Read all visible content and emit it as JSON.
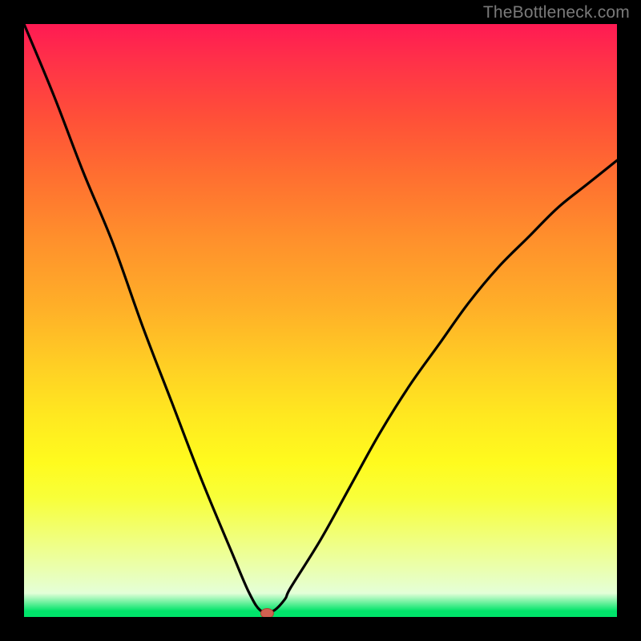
{
  "watermark": "TheBottleneck.com",
  "chart_data": {
    "type": "line",
    "title": "",
    "xlabel": "",
    "ylabel": "",
    "x_range": [
      0,
      100
    ],
    "y_range": [
      0,
      100
    ],
    "series": [
      {
        "name": "bottleneck-curve",
        "x": [
          0,
          5,
          10,
          15,
          20,
          25,
          30,
          35,
          38,
          40,
          42,
          44,
          45,
          50,
          55,
          60,
          65,
          70,
          75,
          80,
          85,
          90,
          95,
          100
        ],
        "y": [
          100,
          88,
          75,
          63,
          49,
          36,
          23,
          11,
          4,
          1,
          1,
          3,
          5,
          13,
          22,
          31,
          39,
          46,
          53,
          59,
          64,
          69,
          73,
          77
        ]
      }
    ],
    "min_point": {
      "x": 41,
      "y": 0.6
    },
    "gradient_stops": [
      {
        "pos": 0,
        "color": "#ff1a53"
      },
      {
        "pos": 50,
        "color": "#ffd024"
      },
      {
        "pos": 75,
        "color": "#fffb1e"
      },
      {
        "pos": 99,
        "color": "#00e46a"
      }
    ]
  }
}
